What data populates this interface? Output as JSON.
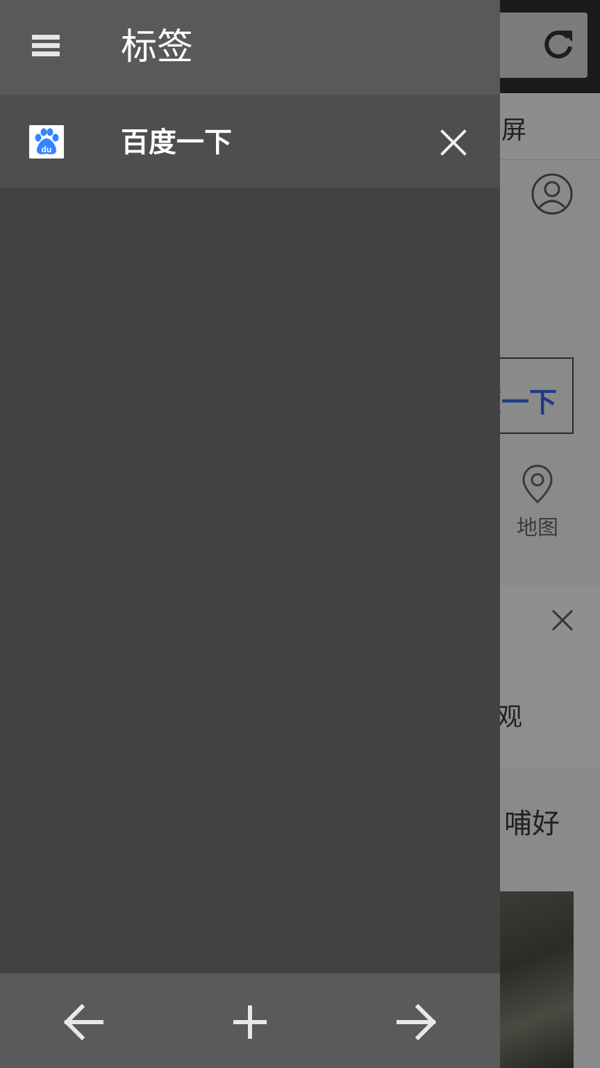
{
  "background_page": {
    "nav_fragment": "屏",
    "search_button_fragment": "度一下",
    "map_label": "地图",
    "card_text_fragment": "观",
    "headline_fragment": "哺好"
  },
  "drawer": {
    "title": "标签",
    "menu_icon": "menu-icon",
    "tabs": [
      {
        "label": "百度一下",
        "favicon": "baidu-paw-icon",
        "favicon_text": "du"
      }
    ]
  },
  "bottom_bar": {
    "back_icon": "arrow-left-icon",
    "new_tab_icon": "plus-icon",
    "forward_icon": "arrow-right-icon"
  },
  "colors": {
    "drawer_bg": "#424242",
    "header_bg": "#595959",
    "tab_item_bg": "#4e4e4e",
    "baidu_blue": "#3385ff"
  }
}
